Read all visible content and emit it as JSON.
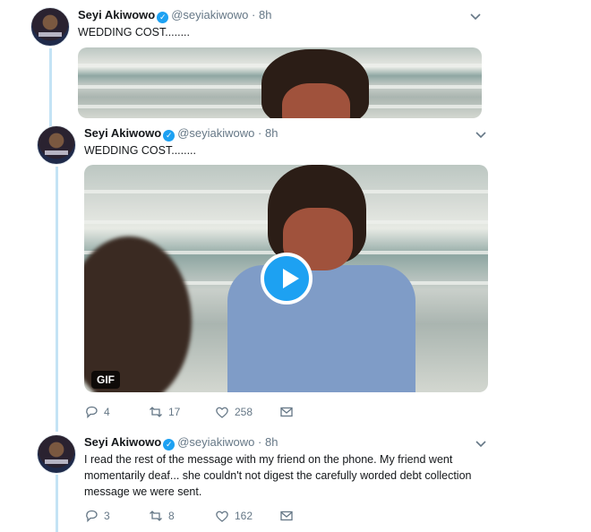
{
  "tweets": [
    {
      "name": "Seyi Akiwowo",
      "handle": "@seyiakiwowo",
      "time": "8h",
      "text": "WEDDING COST........"
    },
    {
      "name": "Seyi Akiwowo",
      "handle": "@seyiakiwowo",
      "time": "8h",
      "text": "WEDDING COST........",
      "gif_label": "GIF",
      "replies": "4",
      "retweets": "17",
      "likes": "258"
    },
    {
      "name": "Seyi Akiwowo",
      "handle": "@seyiakiwowo",
      "time": "8h",
      "text": "I read the rest of the message with my friend on the phone. My friend went momentarily deaf... she couldn't not digest the carefully worded debt collection message we were sent.",
      "replies": "3",
      "retweets": "8",
      "likes": "162"
    }
  ],
  "colors": {
    "accent": "#1da1f2",
    "thread": "#c4e3f5",
    "muted": "#657786"
  }
}
